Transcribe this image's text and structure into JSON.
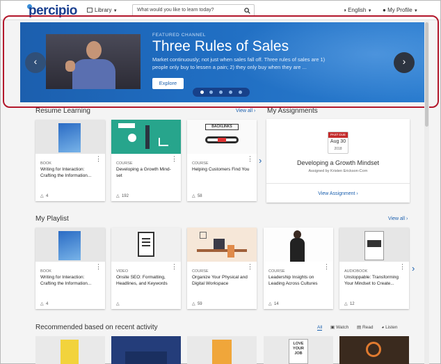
{
  "topbar": {
    "logo": "percipio",
    "library_label": "Library",
    "search_placeholder": "What would you like to learn today?",
    "language": "English",
    "profile": "My Profile"
  },
  "hero": {
    "kicker": "FEATURED CHANNEL",
    "title": "Three Rules of Sales",
    "description": "Market continuously; not just when sales fall off. Three rules of sales are 1) people only buy to lessen a pain; 2) they only buy when they are ...",
    "explore_label": "Explore"
  },
  "resume": {
    "title": "Resume Learning",
    "view_all": "View all",
    "cards": [
      {
        "type": "BOOK",
        "title": "Writing for Interaction: Crafting the Information...",
        "likes": "4"
      },
      {
        "type": "COURSE",
        "title": "Developing a Growth Mind-set",
        "likes": "192"
      },
      {
        "type": "COURSE",
        "title": "Helping Customers Find You",
        "likes": "58",
        "thumb_text": "BACKLINKS"
      }
    ]
  },
  "assignments": {
    "title": "My Assignments",
    "badge": "PAST DUE",
    "date": "Aug 30",
    "year": "2018",
    "course": "Developing a Growth Mindset",
    "assigned_by": "Assigned by Kristen Erickson-Corn",
    "view_label": "View Assignment"
  },
  "playlist": {
    "title": "My Playlist",
    "view_all": "View all",
    "cards": [
      {
        "type": "BOOK",
        "title": "Writing for Interaction: Crafting the Information...",
        "likes": "4"
      },
      {
        "type": "VIDEO",
        "title": "Onsite SEO: Formatting, Headlines, and Keywords",
        "likes": ""
      },
      {
        "type": "COURSE",
        "title": "Organize Your Physical and Digital Workspace",
        "likes": "59"
      },
      {
        "type": "COURSE",
        "title": "Leadership Insights on Leading Across Cultures",
        "likes": "14"
      },
      {
        "type": "AUDIOBOOK",
        "title": "Unstoppable: Transforming Your Mindset to Create...",
        "likes": "12"
      }
    ]
  },
  "recommended": {
    "title": "Recommended based on recent activity",
    "tabs": [
      "All",
      "Watch",
      "Read",
      "Listen"
    ],
    "love_text": "LOVE YOUR JOB"
  },
  "colors": {
    "brand": "#1a5fae",
    "hero": "#1f6cc0",
    "highlight": "#b3172b",
    "past_due": "#c42b2b"
  }
}
